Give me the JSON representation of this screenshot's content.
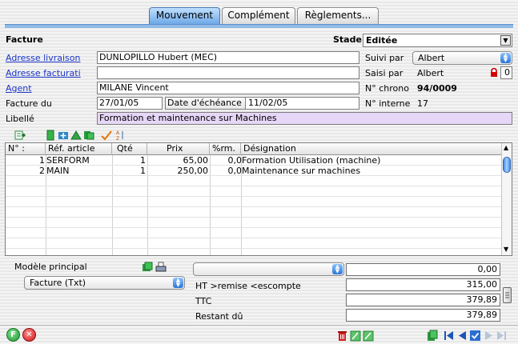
{
  "tabs": [
    {
      "label": "Mouvement",
      "active": true
    },
    {
      "label": "Complément",
      "active": false
    },
    {
      "label": "Règlements...",
      "active": false
    }
  ],
  "form": {
    "section_title": "Facture",
    "stade_label": "Stade",
    "stade_value": "Editée",
    "adresse_livraison_label": "Adresse livraison",
    "adresse_livraison_value": "DUNLOPILLO Hubert (MEC)",
    "adresse_facturation_label": "Adresse facturati",
    "adresse_facturation_value": "",
    "agent_label": "Agent",
    "agent_value": "MILANE Vincent",
    "facture_du_label": "Facture du",
    "facture_du_value": "27/01/05",
    "echeance_label": "Date d'échéance",
    "echeance_value": "11/02/05",
    "libelle_label": "Libellé",
    "libelle_value": "Formation et maintenance sur Machines",
    "suivi_par_label": "Suivi par",
    "suivi_par_value": "Albert",
    "saisi_par_label": "Saisi par",
    "saisi_par_value": "Albert",
    "saisi_par_extra": "0",
    "chrono_label": "N° chrono",
    "chrono_value": "94/0009",
    "interne_label": "N° interne",
    "interne_value": "17"
  },
  "table": {
    "headers": [
      "N° :",
      "Réf. article",
      "Qté",
      "Prix",
      "%rm.",
      "Désignation"
    ],
    "rows": [
      {
        "n": "1",
        "ref": "SERFORM",
        "qte": "1",
        "prix": "65,00",
        "rm": "0,0",
        "designation": "Formation Utilisation (machine)"
      },
      {
        "n": "2",
        "ref": "MAIN",
        "qte": "1",
        "prix": "250,00",
        "rm": "0,0",
        "designation": "Maintenance sur machines"
      }
    ]
  },
  "footer": {
    "modele_label": "Modèle principal",
    "modele_value": "Facture (Txt)",
    "popup_value": "",
    "top_total": "0,00",
    "ht_label": "HT >remise <escompte",
    "ht_value": "315,00",
    "ttc_label": "TTC",
    "ttc_value": "379,89",
    "restant_label": "Restant dû",
    "restant_value": "379,89"
  },
  "colors": {
    "link": "#1a35c9",
    "libelle_bg": "#e6d6f7",
    "tab_active": "#6fa8e6"
  }
}
